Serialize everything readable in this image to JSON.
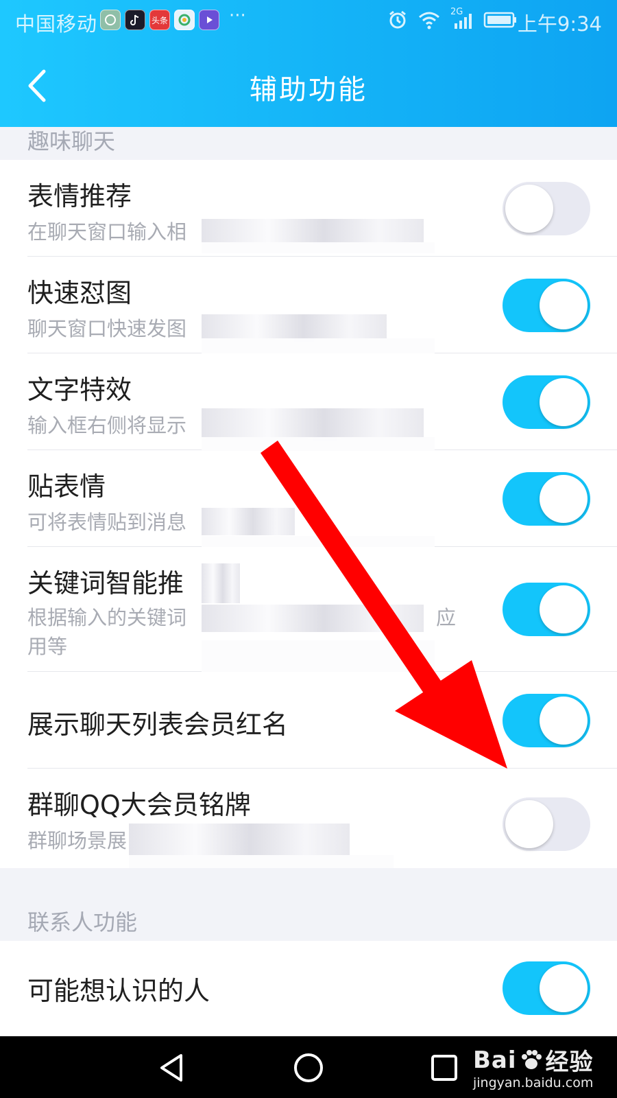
{
  "status_bar": {
    "carrier": "中国移动",
    "notification_icons": [
      "photo-app-icon",
      "tiktok-icon",
      "toutiao-icon",
      "browser-app-icon",
      "video-app-icon"
    ],
    "toutiao_label": "头条",
    "more": "···",
    "network": "2G",
    "time": "上午9:34"
  },
  "title_bar": {
    "title": "辅助功能",
    "back_icon": "chevron-left-icon"
  },
  "sections": {
    "fun_chat": {
      "header": "趣味聊天"
    },
    "contacts": {
      "header": "联系人功能"
    }
  },
  "settings": {
    "emoji_recommend": {
      "title": "表情推荐",
      "desc": "在聊天窗口输入相",
      "enabled": false
    },
    "quick_image": {
      "title": "快速怼图",
      "desc": "聊天窗口快速发图",
      "enabled": true
    },
    "text_effects": {
      "title": "文字特效",
      "desc": "输入框右侧将显示",
      "enabled": true
    },
    "sticker": {
      "title": "贴表情",
      "desc": "可将表情贴到消息",
      "enabled": true
    },
    "keyword_recommend": {
      "title": "关键词智能推",
      "desc_line1": "根据输入的关键词",
      "desc_suffix": "应",
      "desc_line2": "用等",
      "enabled": true
    },
    "vip_red_name": {
      "title": "展示聊天列表会员红名",
      "enabled": true
    },
    "group_vip_badge": {
      "title": "群聊QQ大会员铭牌",
      "desc": "群聊场景展",
      "enabled": false
    },
    "people_you_may_know": {
      "title": "可能想认识的人",
      "enabled": true
    }
  },
  "annotation": {
    "color": "#ff0000",
    "points_to": "群聊QQ大会员铭牌 toggle"
  },
  "nav_bar": {
    "buttons": [
      "back-triangle-icon",
      "home-circle-icon",
      "recents-square-icon"
    ],
    "watermark_brand": "Bai",
    "watermark_brand_suffix": "经验",
    "watermark_url": "jingyan.baidu.com"
  },
  "colors": {
    "header_start": "#1ec8ff",
    "header_end": "#0ea4f2",
    "toggle_on": "#13c5fb",
    "toggle_off": "#e8e9f2"
  }
}
